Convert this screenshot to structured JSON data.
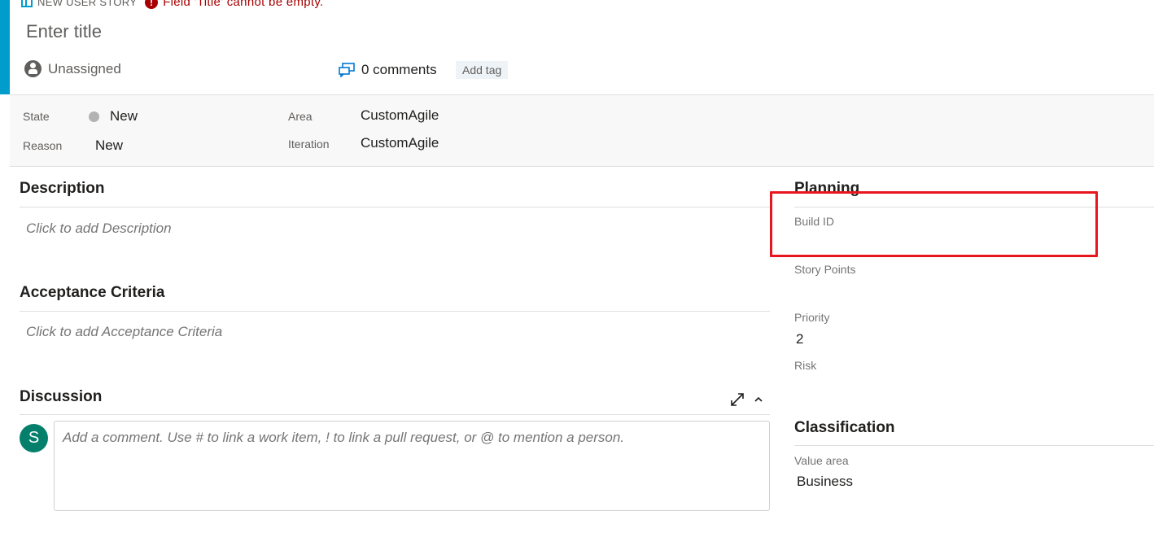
{
  "header": {
    "type_label": "NEW USER STORY",
    "error_icon": "!",
    "error_text": "Field 'Title' cannot be empty.",
    "title_placeholder": "Enter title",
    "assignee": "Unassigned",
    "comments": "0 comments",
    "add_tag": "Add tag"
  },
  "fields": {
    "state_label": "State",
    "state_value": "New",
    "reason_label": "Reason",
    "reason_value": "New",
    "area_label": "Area",
    "area_value": "CustomAgile",
    "iteration_label": "Iteration",
    "iteration_value": "CustomAgile"
  },
  "description": {
    "title": "Description",
    "placeholder": "Click to add Description"
  },
  "acceptance": {
    "title": "Acceptance Criteria",
    "placeholder": "Click to add Acceptance Criteria"
  },
  "discussion": {
    "title": "Discussion",
    "avatar_initial": "S",
    "placeholder": "Add a comment. Use # to link a work item, ! to link a pull request, or @ to mention a person."
  },
  "planning": {
    "title": "Planning",
    "build_id_label": "Build ID",
    "story_points_label": "Story Points",
    "priority_label": "Priority",
    "priority_value": "2",
    "risk_label": "Risk"
  },
  "classification": {
    "title": "Classification",
    "value_area_label": "Value area",
    "value_area_value": "Business"
  },
  "colors": {
    "accent": "#009ccc",
    "error": "#a80000",
    "highlight_box": "#e8161f",
    "avatar": "#047f6b"
  },
  "icons": [
    "book-icon",
    "error-icon",
    "person-icon",
    "comment-icon",
    "expand-icon",
    "chevron-up-icon",
    "state-dot-icon"
  ]
}
